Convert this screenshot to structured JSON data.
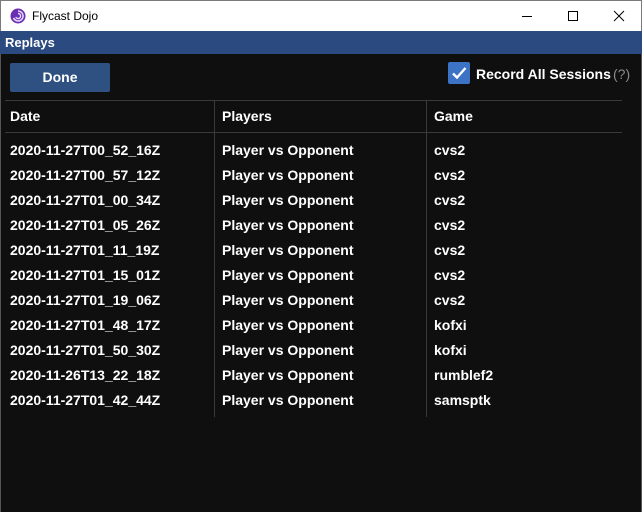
{
  "window": {
    "title": "Flycast Dojo"
  },
  "panel": {
    "title": "Replays"
  },
  "toolbar": {
    "done_label": "Done",
    "record_all_label": "Record All Sessions",
    "record_all_checked": true,
    "help_label": "(?)"
  },
  "table": {
    "headers": [
      "Date",
      "Players",
      "Game"
    ],
    "rows": [
      {
        "date": "2020-11-27T00_52_16Z",
        "players": "Player vs Opponent",
        "game": "cvs2"
      },
      {
        "date": "2020-11-27T00_57_12Z",
        "players": "Player vs Opponent",
        "game": "cvs2"
      },
      {
        "date": "2020-11-27T01_00_34Z",
        "players": "Player vs Opponent",
        "game": "cvs2"
      },
      {
        "date": "2020-11-27T01_05_26Z",
        "players": "Player vs Opponent",
        "game": "cvs2"
      },
      {
        "date": "2020-11-27T01_11_19Z",
        "players": "Player vs Opponent",
        "game": "cvs2"
      },
      {
        "date": "2020-11-27T01_15_01Z",
        "players": "Player vs Opponent",
        "game": "cvs2"
      },
      {
        "date": "2020-11-27T01_19_06Z",
        "players": "Player vs Opponent",
        "game": "cvs2"
      },
      {
        "date": "2020-11-27T01_48_17Z",
        "players": "Player vs Opponent",
        "game": "kofxi"
      },
      {
        "date": "2020-11-27T01_50_30Z",
        "players": "Player vs Opponent",
        "game": "kofxi"
      },
      {
        "date": "2020-11-26T13_22_18Z",
        "players": "Player vs Opponent",
        "game": "rumblef2"
      },
      {
        "date": "2020-11-27T01_42_44Z",
        "players": "Player vs Opponent",
        "game": "samsptk"
      }
    ]
  },
  "colors": {
    "accent": "#2a4a80",
    "button": "#2e5182",
    "checkbox": "#3d73c4",
    "background": "#0f0f0f"
  },
  "icons": {
    "app": "flycast-swirl-icon",
    "minimize": "minimize-icon",
    "maximize": "maximize-icon",
    "close": "close-icon",
    "check": "checkmark-icon"
  }
}
